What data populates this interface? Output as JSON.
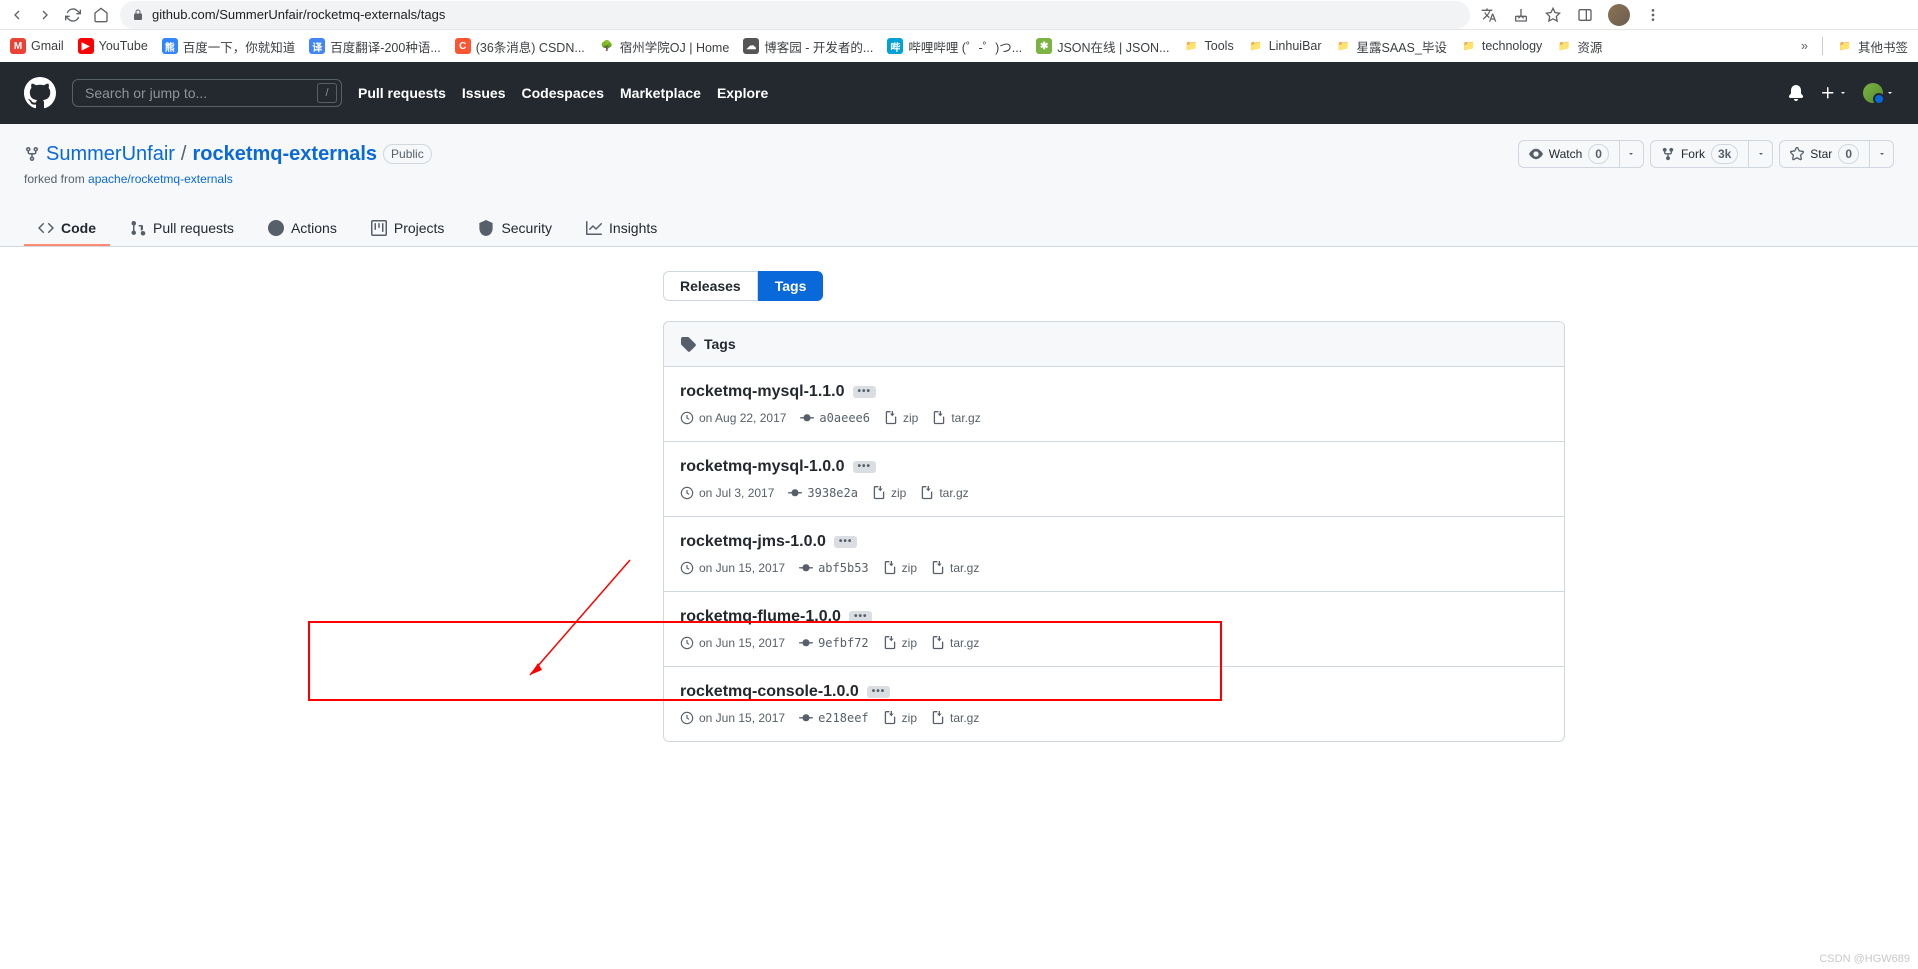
{
  "chrome": {
    "url": "github.com/SummerUnfair/rocketmq-externals/tags",
    "bookmarks": [
      {
        "icon": "M",
        "bg": "#ea4335",
        "label": "Gmail"
      },
      {
        "icon": "▶",
        "bg": "#ff0000",
        "label": "YouTube"
      },
      {
        "icon": "熊",
        "bg": "#3385ff",
        "label": "百度一下，你就知道"
      },
      {
        "icon": "译",
        "bg": "#4285f4",
        "label": "百度翻译-200种语..."
      },
      {
        "icon": "C",
        "bg": "#fc5531",
        "label": "(36条消息) CSDN..."
      },
      {
        "icon": "🌳",
        "bg": "transparent",
        "label": "宿州学院OJ | Home"
      },
      {
        "icon": "☁",
        "bg": "#555",
        "label": "博客园 - 开发者的..."
      },
      {
        "icon": "哔",
        "bg": "#00a1d6",
        "label": "哔哩哔哩 (゜-゜)つ..."
      },
      {
        "icon": "✱",
        "bg": "#7cb342",
        "label": "JSON在线 | JSON..."
      },
      {
        "icon": "📁",
        "bg": "transparent",
        "label": "Tools"
      },
      {
        "icon": "📁",
        "bg": "transparent",
        "label": "LinhuiBar"
      },
      {
        "icon": "📁",
        "bg": "transparent",
        "label": "星露SAAS_毕设"
      },
      {
        "icon": "📁",
        "bg": "transparent",
        "label": "technology"
      },
      {
        "icon": "📁",
        "bg": "transparent",
        "label": "资源"
      }
    ],
    "other_bookmarks": "其他书签"
  },
  "gh_nav": {
    "search_ph": "Search or jump to...",
    "items": [
      "Pull requests",
      "Issues",
      "Codespaces",
      "Marketplace",
      "Explore"
    ]
  },
  "repo": {
    "owner": "SummerUnfair",
    "name": "rocketmq-externals",
    "visibility": "Public",
    "forked_prefix": "forked from ",
    "forked_from": "apache/rocketmq-externals",
    "watch": {
      "label": "Watch",
      "count": "0"
    },
    "fork": {
      "label": "Fork",
      "count": "3k"
    },
    "star": {
      "label": "Star",
      "count": "0"
    }
  },
  "tabs": [
    "Code",
    "Pull requests",
    "Actions",
    "Projects",
    "Security",
    "Insights"
  ],
  "pill_tabs": {
    "releases": "Releases",
    "tags": "Tags"
  },
  "tags_header": "Tags",
  "tags": [
    {
      "name": "rocketmq-mysql-1.1.0",
      "date": "on Aug 22, 2017",
      "commit": "a0aeee6",
      "zip": "zip",
      "targz": "tar.gz"
    },
    {
      "name": "rocketmq-mysql-1.0.0",
      "date": "on Jul 3, 2017",
      "commit": "3938e2a",
      "zip": "zip",
      "targz": "tar.gz"
    },
    {
      "name": "rocketmq-jms-1.0.0",
      "date": "on Jun 15, 2017",
      "commit": "abf5b53",
      "zip": "zip",
      "targz": "tar.gz"
    },
    {
      "name": "rocketmq-flume-1.0.0",
      "date": "on Jun 15, 2017",
      "commit": "9efbf72",
      "zip": "zip",
      "targz": "tar.gz"
    },
    {
      "name": "rocketmq-console-1.0.0",
      "date": "on Jun 15, 2017",
      "commit": "e218eef",
      "zip": "zip",
      "targz": "tar.gz"
    }
  ],
  "watermark": "CSDN @HGW689"
}
